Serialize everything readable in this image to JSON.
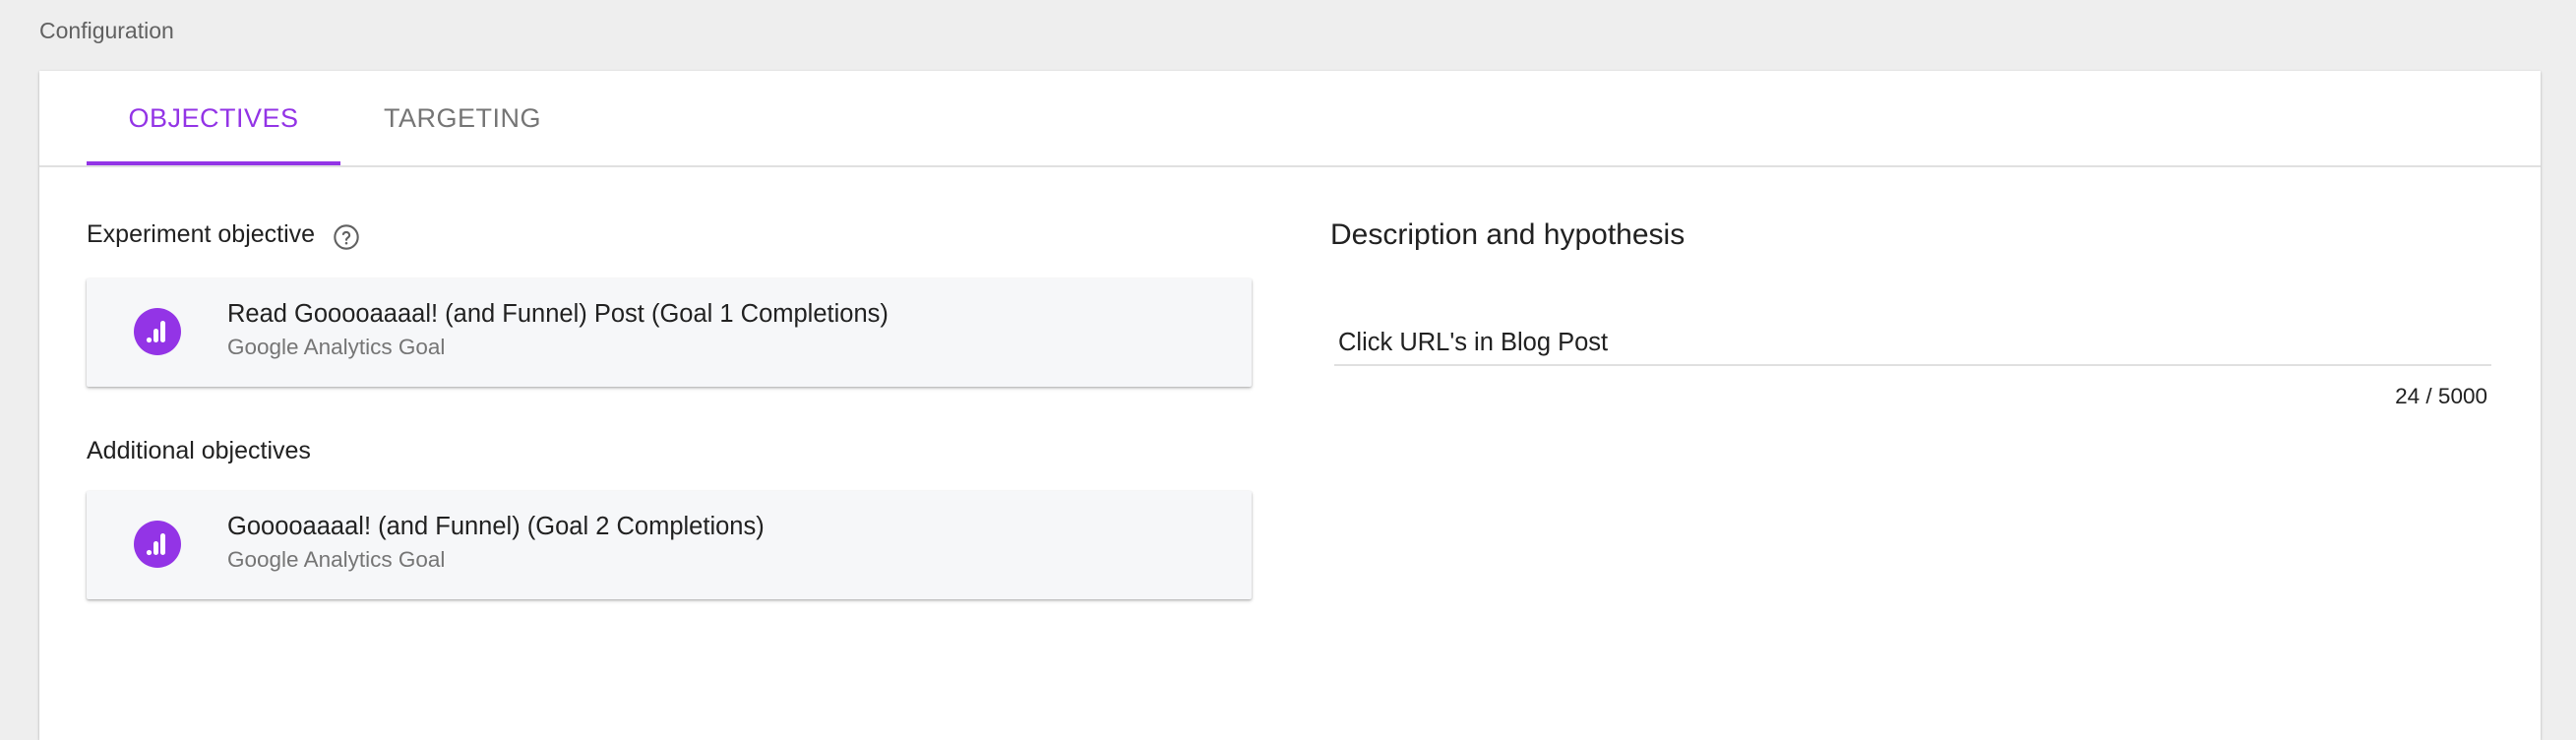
{
  "page": {
    "heading": "Configuration"
  },
  "tabs": [
    {
      "label": "OBJECTIVES",
      "active": true
    },
    {
      "label": "TARGETING",
      "active": false
    }
  ],
  "objectives": {
    "experiment_label": "Experiment objective",
    "experiment_goal": {
      "title": "Read Gooooaaaal! (and Funnel) Post (Goal 1 Completions)",
      "subtitle": "Google Analytics Goal",
      "icon": "analytics-icon"
    },
    "additional_label": "Additional objectives",
    "additional_goals": [
      {
        "title": "Gooooaaaal! (and Funnel) (Goal 2 Completions)",
        "subtitle": "Google Analytics Goal",
        "icon": "analytics-icon"
      }
    ]
  },
  "description": {
    "heading": "Description and hypothesis",
    "value": "Click URL's in Blog Post",
    "counter": "24 / 5000"
  },
  "colors": {
    "accent": "#9334e6",
    "background": "#eeeeee",
    "card": "#ffffff",
    "goal_card": "#f6f7f9"
  }
}
